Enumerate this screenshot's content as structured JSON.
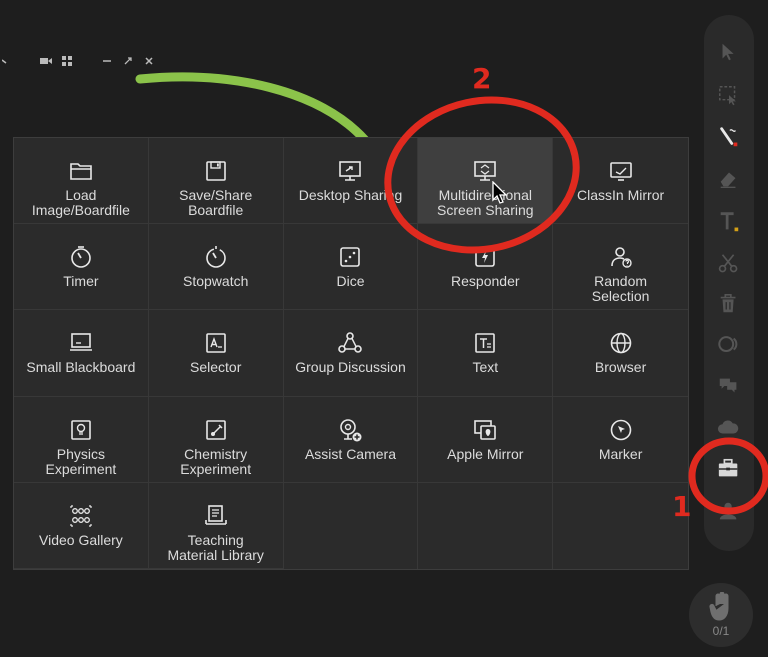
{
  "tools_panel": {
    "items": [
      {
        "label": "Load\nImage/Boardfile",
        "icon": "folder-icon"
      },
      {
        "label": "Save/Share\nBoardfile",
        "icon": "save-icon"
      },
      {
        "label": "Desktop Sharing",
        "icon": "desktop-share-icon"
      },
      {
        "label": "Multidirectional\nScreen Sharing",
        "icon": "multi-screen-share-icon"
      },
      {
        "label": "ClassIn Mirror",
        "icon": "mirror-icon"
      },
      {
        "label": "Timer",
        "icon": "timer-icon"
      },
      {
        "label": "Stopwatch",
        "icon": "stopwatch-icon"
      },
      {
        "label": "Dice",
        "icon": "dice-icon"
      },
      {
        "label": "Responder",
        "icon": "responder-icon"
      },
      {
        "label": "Random\nSelection",
        "icon": "random-selection-icon"
      },
      {
        "label": "Small Blackboard",
        "icon": "small-blackboard-icon"
      },
      {
        "label": "Selector",
        "icon": "selector-icon"
      },
      {
        "label": "Group Discussion",
        "icon": "group-discussion-icon"
      },
      {
        "label": "Text",
        "icon": "text-icon"
      },
      {
        "label": "Browser",
        "icon": "browser-icon"
      },
      {
        "label": "Physics\nExperiment",
        "icon": "physics-icon"
      },
      {
        "label": "Chemistry\nExperiment",
        "icon": "chemistry-icon"
      },
      {
        "label": "Assist Camera",
        "icon": "assist-camera-icon"
      },
      {
        "label": "Apple Mirror",
        "icon": "apple-mirror-icon"
      },
      {
        "label": "Marker",
        "icon": "marker-icon"
      },
      {
        "label": "Video Gallery",
        "icon": "video-gallery-icon"
      },
      {
        "label": "Teaching\nMaterial Library",
        "icon": "material-library-icon"
      }
    ]
  },
  "right_toolbar": {
    "tools": [
      "select-arrow-icon",
      "area-select-icon",
      "pen-icon",
      "eraser-icon",
      "text-tool-icon",
      "scissors-icon",
      "trash-icon",
      "shape-icon",
      "chat-icon",
      "cloud-icon",
      "toolbox-icon",
      "users-icon"
    ]
  },
  "hand_raise": {
    "count": "0/1"
  },
  "annotations": {
    "step1": "1",
    "step2": "2"
  },
  "colors": {
    "annotation_red": "#e02a1f",
    "curve_green": "#8bc34a",
    "panel_bg": "#2b2b2b",
    "highlight_bg": "#3f3f3f"
  }
}
